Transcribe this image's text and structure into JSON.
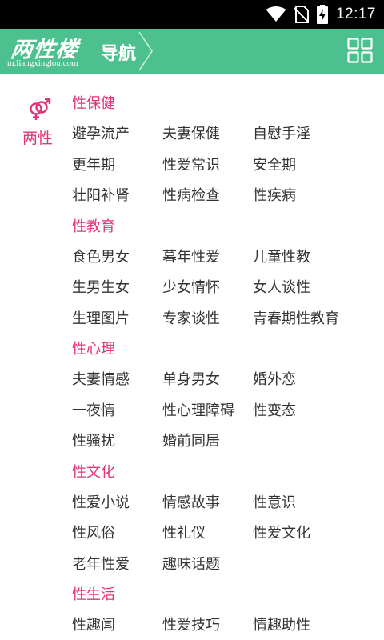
{
  "status_bar": {
    "time": "12:17",
    "icons": [
      "wifi-icon",
      "no-sim-icon",
      "battery-charging-icon"
    ]
  },
  "header": {
    "logo_text": "两性楼",
    "logo_domain": "m.liangxinglou.com",
    "breadcrumb": "导航",
    "menu_icon": "grid-menu-icon"
  },
  "colors": {
    "header_bg": "#4cc18f",
    "accent": "#e0357a",
    "text": "#333333"
  },
  "sidebar": {
    "icon": "gender-symbol-icon",
    "label": "两性"
  },
  "sections": [
    {
      "title": "性保健",
      "rows": [
        [
          "避孕流产",
          "夫妻保健",
          "自慰手淫"
        ],
        [
          "更年期",
          "性爱常识",
          "安全期"
        ],
        [
          "壮阳补肾",
          "性病检查",
          "性疾病"
        ]
      ]
    },
    {
      "title": "性教育",
      "rows": [
        [
          "食色男女",
          "暮年性爱",
          "儿童性教"
        ],
        [
          "生男生女",
          "少女情怀",
          "女人谈性"
        ],
        [
          "生理图片",
          "专家谈性",
          "青春期性教育"
        ]
      ]
    },
    {
      "title": "性心理",
      "rows": [
        [
          "夫妻情感",
          "单身男女",
          "婚外恋"
        ],
        [
          "一夜情",
          "性心理障碍",
          "性变态"
        ],
        [
          "性骚扰",
          "婚前同居",
          ""
        ]
      ]
    },
    {
      "title": "性文化",
      "rows": [
        [
          "性爱小说",
          "情感故事",
          "性意识"
        ],
        [
          "性风俗",
          "性礼仪",
          "性爱文化"
        ],
        [
          "老年性爱",
          "趣味话题",
          ""
        ]
      ]
    },
    {
      "title": "性生活",
      "rows": [
        [
          "性趣闻",
          "性爱技巧",
          "情趣助性"
        ]
      ]
    }
  ]
}
